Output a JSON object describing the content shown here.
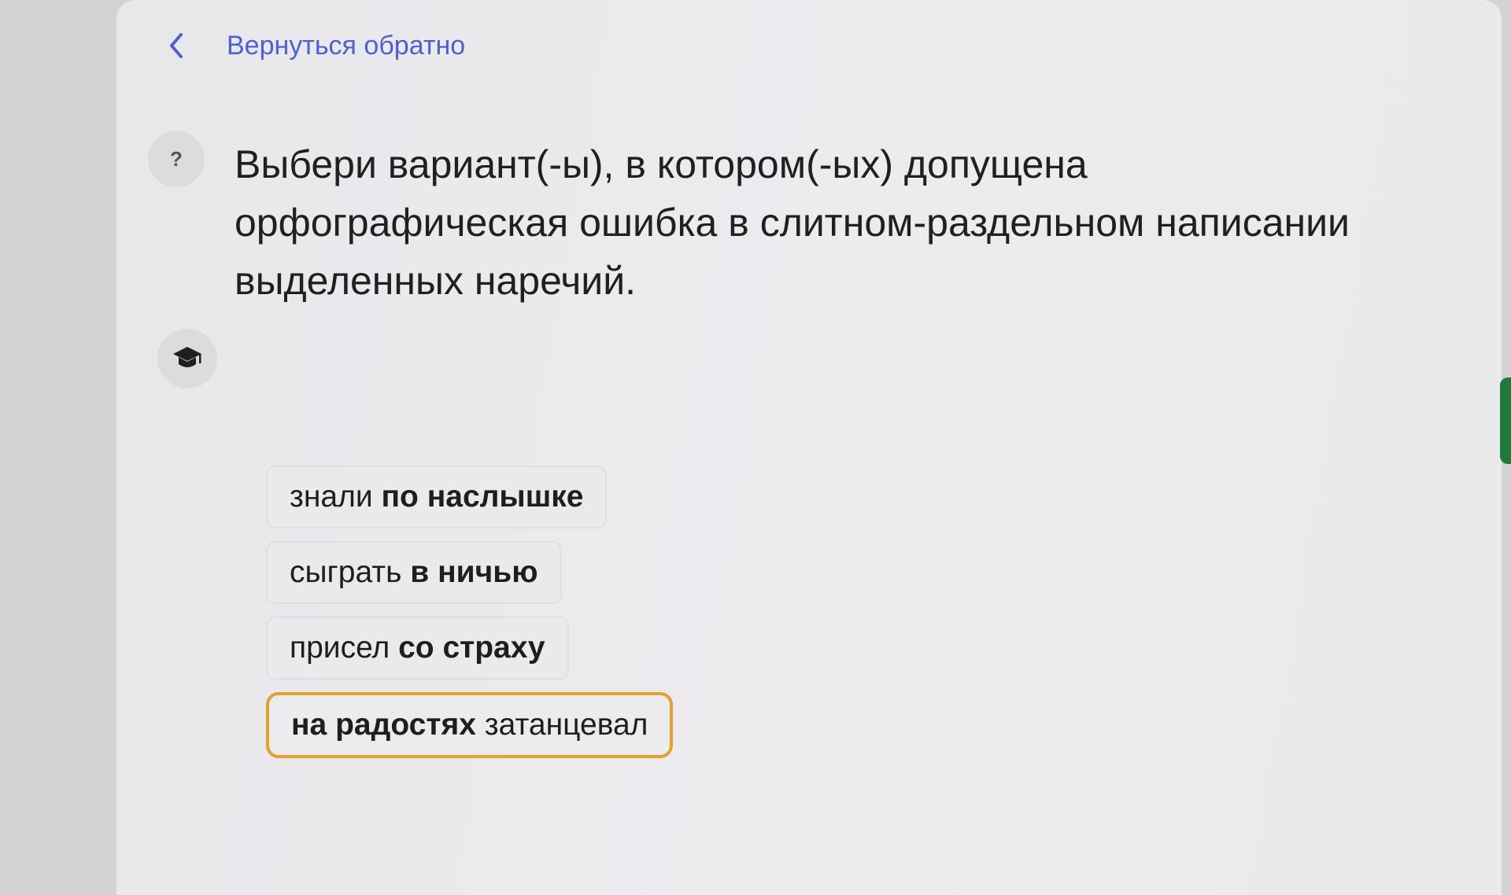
{
  "back": {
    "label": "Вернуться обратно"
  },
  "question": {
    "text": "Выбери вариант(-ы), в котором(-ых) допущена орфографическая ошибка в слитном-раздельном написании выделенных наречий."
  },
  "icons": {
    "help": "question-icon",
    "theory": "graduation-cap-icon",
    "back": "chevron-left-icon"
  },
  "options": [
    {
      "plain": "знали ",
      "bold": "по наслышке",
      "bold_first": false,
      "selected": false
    },
    {
      "plain": "сыграть ",
      "bold": "в ничью",
      "bold_first": false,
      "selected": false
    },
    {
      "plain": "присел ",
      "bold": "со страху",
      "bold_first": false,
      "selected": false
    },
    {
      "bold": "на радостях",
      "plain": " затанцевал",
      "bold_first": true,
      "selected": true
    }
  ],
  "colors": {
    "accent_link": "#4f5fd6",
    "selected_border": "#e3a12f",
    "background": "#e9e8eb"
  }
}
